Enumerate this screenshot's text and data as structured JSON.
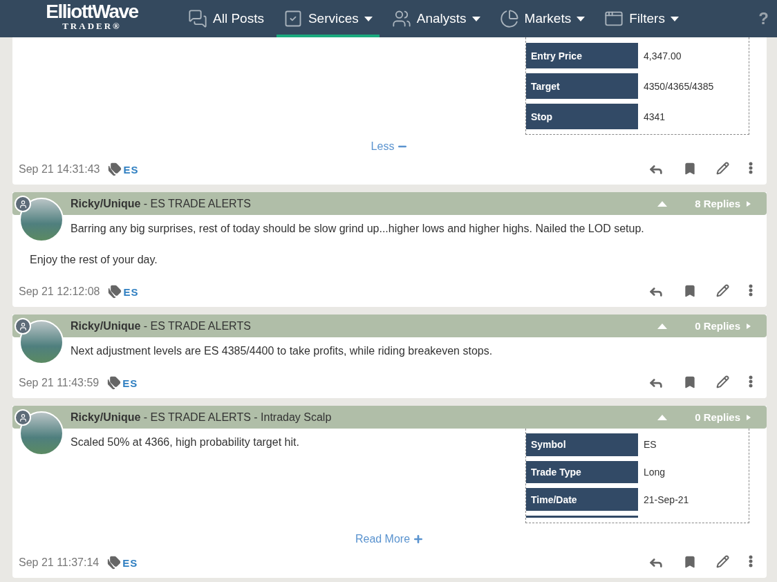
{
  "nav": {
    "logo": {
      "name": "ElliottWave",
      "sub": "TRADER",
      "mark": "®"
    },
    "items": [
      {
        "label": "All Posts",
        "selected": false,
        "dropdown": false
      },
      {
        "label": "Services",
        "selected": true,
        "dropdown": true
      },
      {
        "label": "Analysts",
        "selected": false,
        "dropdown": true
      },
      {
        "label": "Markets",
        "selected": false,
        "dropdown": true
      },
      {
        "label": "Filters",
        "selected": false,
        "dropdown": true
      }
    ],
    "help": "?"
  },
  "posts": [
    {
      "trade_table": [
        {
          "label": "Entry Price",
          "value": "4,347.00"
        },
        {
          "label": "Target",
          "value": "4350/4365/4385"
        },
        {
          "label": "Stop",
          "value": "4341"
        }
      ],
      "toggle": {
        "kind": "less",
        "label": "Less"
      },
      "timestamp": "Sep 21 14:31:43",
      "tag": "ES"
    },
    {
      "author": "Ricky/Unique",
      "title": " - ES TRADE ALERTS",
      "replies": "8 Replies",
      "paragraphs": [
        "Barring any big surprises, rest of today should be slow grind up...higher lows and higher highs. Nailed the LOD setup.",
        "Enjoy the rest of your day."
      ],
      "timestamp": "Sep 21 12:12:08",
      "tag": "ES"
    },
    {
      "author": "Ricky/Unique",
      "title": " - ES TRADE ALERTS",
      "replies": "0 Replies",
      "paragraphs": [
        "Next adjustment levels are ES 4385/4400 to take profits, while riding breakeven stops."
      ],
      "timestamp": "Sep 21 11:43:59",
      "tag": "ES"
    },
    {
      "author": "Ricky/Unique",
      "title": " - ES TRADE ALERTS - Intraday Scalp",
      "replies": "0 Replies",
      "paragraphs": [
        "Scaled 50% at 4366, high probability target hit."
      ],
      "trade_table": [
        {
          "label": "Symbol",
          "value": "ES"
        },
        {
          "label": "Trade Type",
          "value": "Long"
        },
        {
          "label": "Time/Date",
          "value": "21-Sep-21"
        }
      ],
      "toggle": {
        "kind": "more",
        "label": "Read More"
      },
      "timestamp": "Sep 21 11:37:14",
      "tag": "ES"
    }
  ]
}
